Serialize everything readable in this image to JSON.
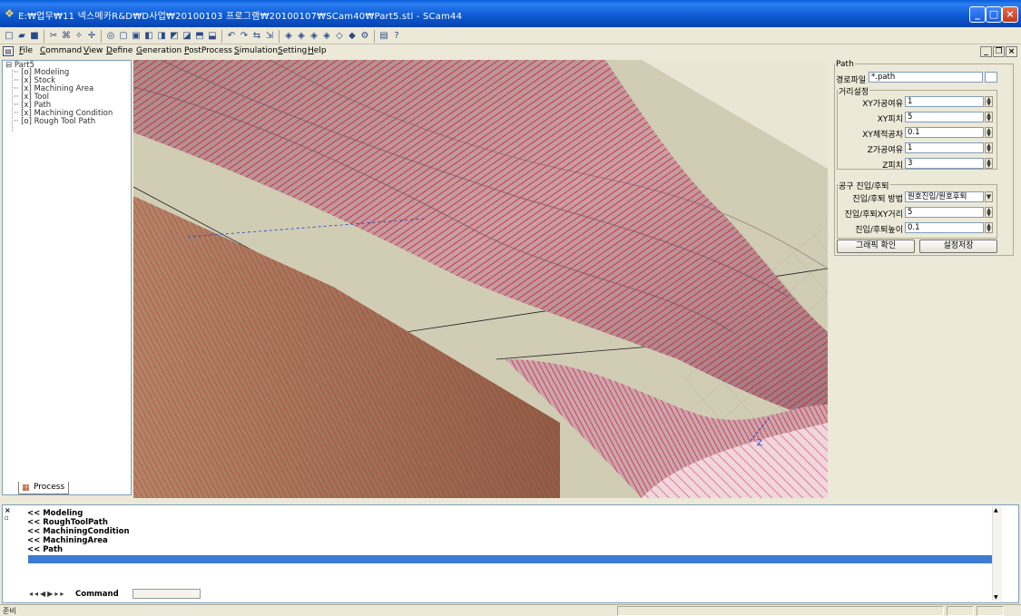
{
  "window": {
    "title": "E:₩업무₩11 넥스메카R&D₩D사업₩20100103 프로그램₩20100107₩SCam40₩Part5.stl - SCam44"
  },
  "menu": {
    "items": [
      "File",
      "Command",
      "View",
      "Define",
      "Generation",
      "PostProcess",
      "Simulation",
      "Setting",
      "Help"
    ]
  },
  "tree": {
    "root": "Part5",
    "items": [
      "[o] Modeling",
      "[x] Stock",
      "[x] Machining Area",
      "[x] Tool",
      "[x] Path",
      "[x] Machining Condition",
      "[o] Rough Tool Path"
    ],
    "selected_index": 4,
    "tab_label": "Process"
  },
  "path_panel": {
    "group_title": "Path",
    "file_label": "경로파일",
    "file_value": "*.path",
    "distance_group": "거리설정",
    "distance_fields": [
      {
        "label": "XY가공여유",
        "value": "1"
      },
      {
        "label": "XY피치",
        "value": "5"
      },
      {
        "label": "XY체적공차",
        "value": "0.1"
      },
      {
        "label": "Z가공여유",
        "value": "1"
      },
      {
        "label": "Z피치",
        "value": "3"
      }
    ],
    "approach_group": "공구 진입/후퇴",
    "approach_method_label": "진입/후퇴 방법",
    "approach_method_value": "원호진입/원호후퇴",
    "approach_fields": [
      {
        "label": "진입/후퇴XY거리",
        "value": "5"
      },
      {
        "label": "진입/후퇴높이",
        "value": "0.1"
      }
    ],
    "graphic_button": "그래픽 확인",
    "save_button": "설정저장"
  },
  "command_window": {
    "lines": [
      "<< Modeling",
      "<< RoughToolPath",
      "<< MachiningCondition",
      "<< MachiningArea",
      "<< Path"
    ],
    "tab_label": "Command"
  },
  "status": {
    "text": "준비"
  },
  "colors": {
    "titlebar": "#0b58d0",
    "selection": "#316ac5",
    "toolpath": "#e02020",
    "surface": "#b08a72"
  }
}
